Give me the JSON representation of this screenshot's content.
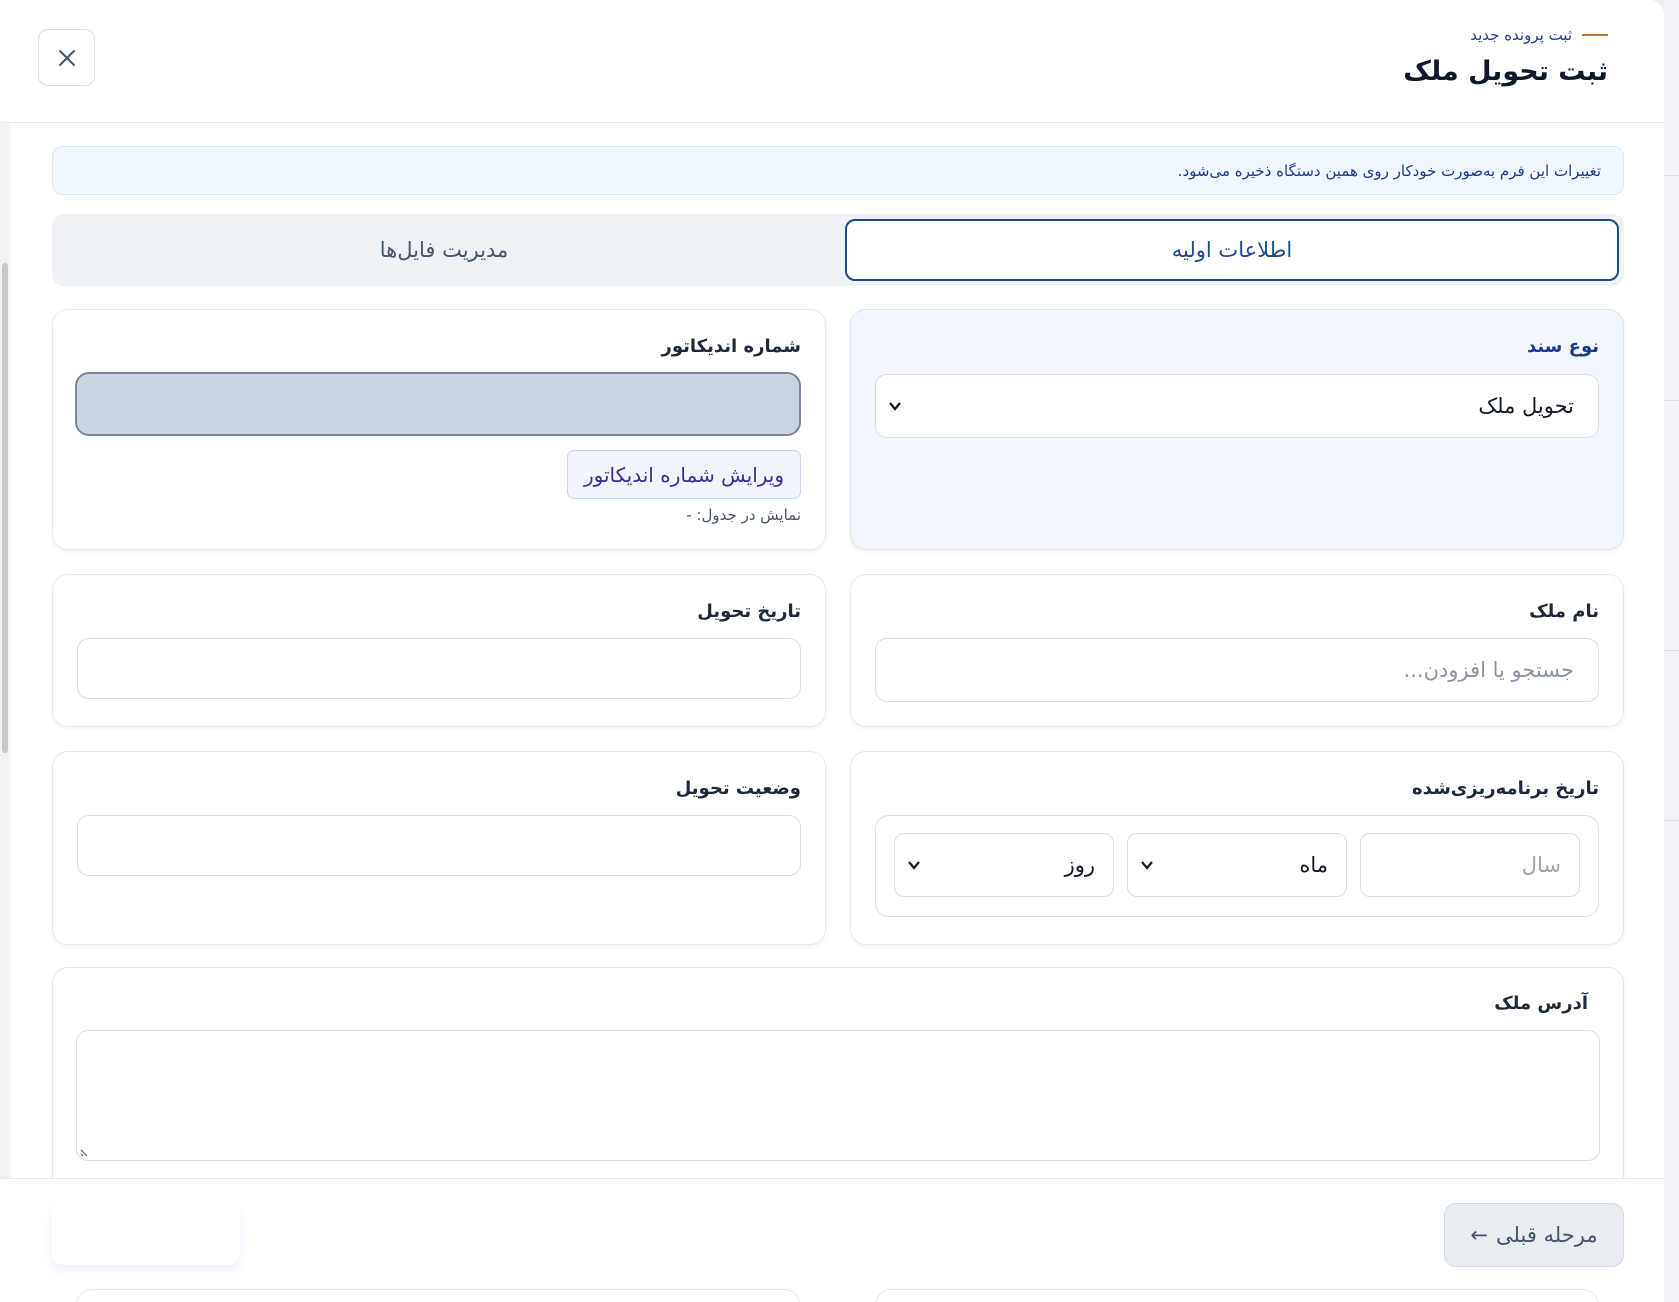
{
  "header": {
    "eyebrow": "ثبت پرونده جدید",
    "title": "ثبت تحویل ملک"
  },
  "notice": "تغییرات این فرم به‌صورت خودکار روی همین دستگاه ذخیره می‌شود.",
  "tabs": [
    {
      "label": "اطلاعات اولیه",
      "active": true
    },
    {
      "label": "مدیریت فایل‌ها",
      "active": false
    }
  ],
  "fields": {
    "doc_type": {
      "label": "نوع سند",
      "value": "تحویل ملک"
    },
    "indicator": {
      "label": "شماره اندیکاتور",
      "value": "",
      "edit_label": "ویرایش شماره اندیکاتور",
      "help": "نمایش در جدول: -"
    },
    "property_name": {
      "label": "نام ملک",
      "placeholder": "جستجو یا افزودن..."
    },
    "delivery_date": {
      "label": "تاریخ تحویل",
      "value": ""
    },
    "scheduled_date": {
      "label": "تاریخ برنامه‌ریزی‌شده",
      "year_placeholder": "سال",
      "month": "ماه",
      "day": "روز"
    },
    "delivery_status": {
      "label": "وضعیت تحویل",
      "value": ""
    },
    "address": {
      "label": "آدرس ملک",
      "value": ""
    }
  },
  "footer": {
    "back_label": "مرحله قبلی",
    "back_arrow": "←"
  },
  "colors": {
    "accent": "#1e4a8c",
    "eyebrow_dash": "#b7791f",
    "notice_bg": "#f1f7fe"
  },
  "icons": {
    "close": "close-icon",
    "chevron": "chevron-down-icon",
    "arrow": "arrow-left-icon"
  }
}
